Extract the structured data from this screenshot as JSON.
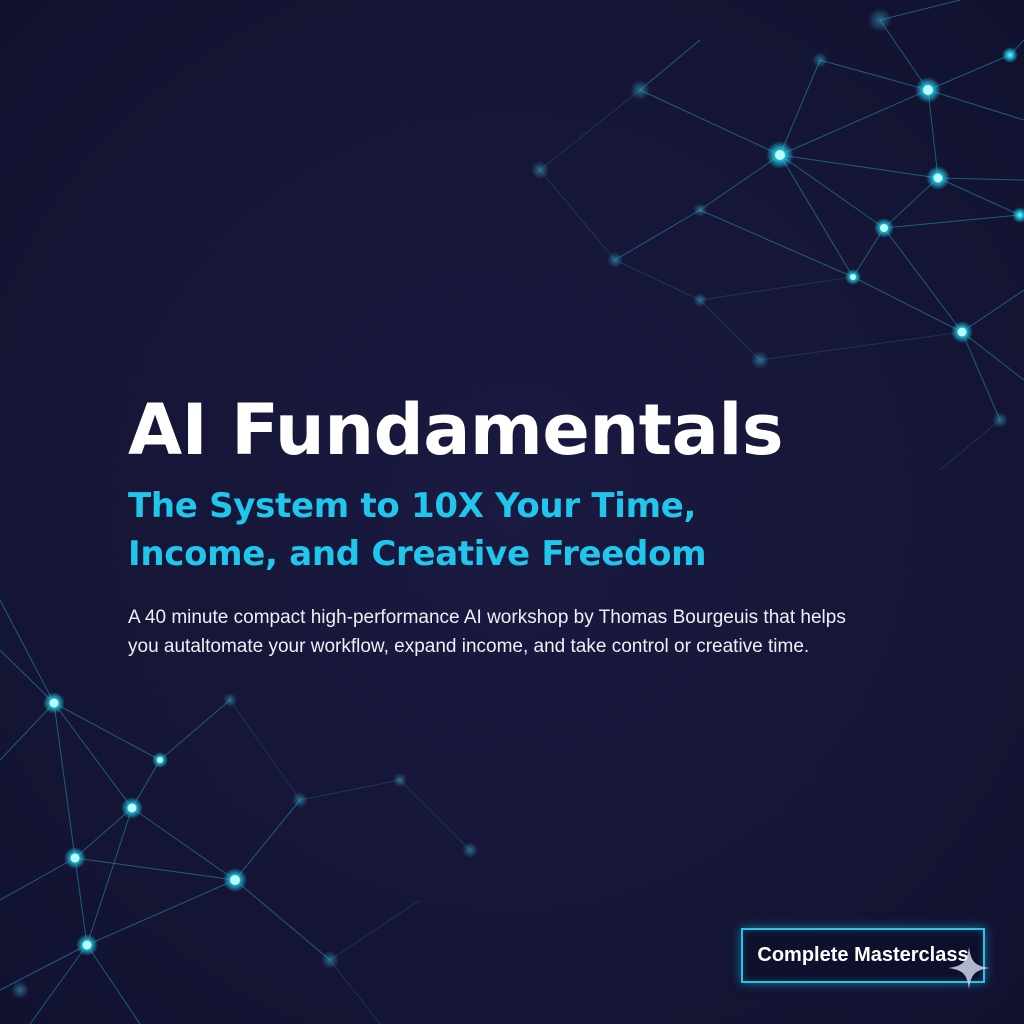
{
  "hero": {
    "title": "AI Fundamentals",
    "subtitle": "The System to 10X Your Time, Income, and Creative Freedom",
    "description_line1": "A 40 minute compact high-performance AI workshop by Thomas Bourgeuis that helps",
    "description_line2": "you autaltomate your workflow, expand  income, and take control or creative time."
  },
  "cta": {
    "label": "Complete Masterclass"
  },
  "colors": {
    "background": "#16163a",
    "accent": "#21c6ec",
    "title": "#ffffff",
    "body_text": "#eef0f6"
  },
  "icons": {
    "decoration": "sparkle-icon",
    "background_art": "network-graph"
  }
}
